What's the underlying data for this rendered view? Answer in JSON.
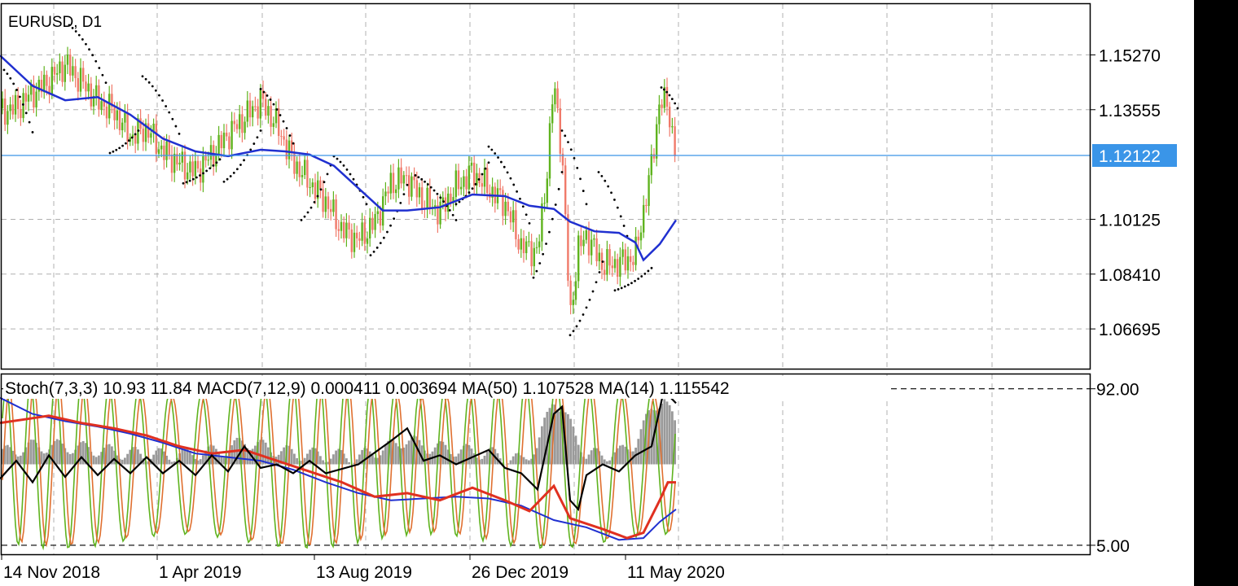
{
  "symbol_label": "EURUSD, D1",
  "current_price_label": "1.12122",
  "indicator_label": "Stoch(7,3,3) 10.93 11.84 MACD(7,12,9) 0.000411 0.003694 MA(50) 1.107528 MA(14) 1.115542",
  "colors": {
    "bull_candle": "#5fb31e",
    "bear_candle": "#f07a6a",
    "ma_line": "#2030d0",
    "sar_dots": "#000000",
    "price_line": "#3a95e8",
    "stoch_main": "#5fb31e",
    "stoch_signal": "#e07030",
    "macd_hist": "#9a9a9a",
    "macd_line": "#000000",
    "ma50_line": "#2030d0",
    "ma14_line": "#e03020",
    "grid": "#b0b0b0"
  },
  "chart_data": [
    {
      "type": "candlestick",
      "symbol": "EURUSD",
      "timeframe": "D1",
      "x_tick_labels": [
        "14 Nov 2018",
        "1 Apr 2019",
        "13 Aug 2019",
        "26 Dec 2019",
        "11 May 2020"
      ],
      "y_tick_labels": [
        "1.15270",
        "1.13555",
        "1.10125",
        "1.08410",
        "1.06695"
      ],
      "y_ticks": [
        1.1527,
        1.13555,
        1.10125,
        1.0841,
        1.06695
      ],
      "ylim": [
        1.0545,
        1.1686
      ],
      "current_price": 1.12122,
      "grid": true,
      "close_series": [
        [
          0,
          1.136
        ],
        [
          20,
          1.138
        ],
        [
          40,
          1.143
        ],
        [
          60,
          1.146
        ],
        [
          80,
          1.15
        ],
        [
          100,
          1.143
        ],
        [
          120,
          1.136
        ],
        [
          140,
          1.133
        ],
        [
          160,
          1.126
        ],
        [
          180,
          1.13
        ],
        [
          200,
          1.124
        ],
        [
          220,
          1.121
        ],
        [
          240,
          1.118
        ],
        [
          260,
          1.122
        ],
        [
          280,
          1.127
        ],
        [
          300,
          1.131
        ],
        [
          320,
          1.136
        ],
        [
          340,
          1.129
        ],
        [
          360,
          1.119
        ],
        [
          380,
          1.114
        ],
        [
          400,
          1.109
        ],
        [
          420,
          1.1
        ],
        [
          440,
          1.096
        ],
        [
          460,
          1.1
        ],
        [
          480,
          1.111
        ],
        [
          500,
          1.112
        ],
        [
          520,
          1.105
        ],
        [
          540,
          1.103
        ],
        [
          560,
          1.112
        ],
        [
          580,
          1.118
        ],
        [
          600,
          1.113
        ],
        [
          620,
          1.108
        ],
        [
          640,
          1.093
        ],
        [
          660,
          1.09
        ],
        [
          670,
          1.11
        ],
        [
          680,
          1.142
        ],
        [
          690,
          1.12
        ],
        [
          700,
          1.068
        ],
        [
          710,
          1.09
        ],
        [
          720,
          1.095
        ],
        [
          740,
          1.087
        ],
        [
          760,
          1.089
        ],
        [
          780,
          1.092
        ],
        [
          800,
          1.12
        ],
        [
          810,
          1.14
        ],
        [
          820,
          1.138
        ],
        [
          830,
          1.121
        ]
      ],
      "sma_series": [
        [
          0,
          1.1525
        ],
        [
          40,
          1.143
        ],
        [
          80,
          1.1385
        ],
        [
          120,
          1.1395
        ],
        [
          160,
          1.134
        ],
        [
          200,
          1.1265
        ],
        [
          240,
          1.1225
        ],
        [
          280,
          1.121
        ],
        [
          320,
          1.123
        ],
        [
          350,
          1.1225
        ],
        [
          380,
          1.1215
        ],
        [
          410,
          1.118
        ],
        [
          440,
          1.111
        ],
        [
          470,
          1.104
        ],
        [
          500,
          1.104
        ],
        [
          540,
          1.105
        ],
        [
          580,
          1.109
        ],
        [
          620,
          1.1085
        ],
        [
          650,
          1.1055
        ],
        [
          680,
          1.1045
        ],
        [
          700,
          1.1005
        ],
        [
          730,
          1.0975
        ],
        [
          760,
          1.097
        ],
        [
          780,
          1.094
        ],
        [
          790,
          1.0885
        ],
        [
          810,
          1.0935
        ],
        [
          830,
          1.101
        ]
      ],
      "sar_segments": [
        {
          "x": [
            5,
            40
          ],
          "y": [
            1.148,
            1.1285
          ]
        },
        {
          "x": [
            85,
            130
          ],
          "y": [
            1.162,
            1.144
          ]
        },
        {
          "x": [
            135,
            170
          ],
          "y": [
            1.122,
            1.129
          ]
        },
        {
          "x": [
            175,
            220
          ],
          "y": [
            1.146,
            1.128
          ]
        },
        {
          "x": [
            225,
            270
          ],
          "y": [
            1.1125,
            1.12
          ]
        },
        {
          "x": [
            275,
            320
          ],
          "y": [
            1.113,
            1.129
          ]
        },
        {
          "x": [
            320,
            360
          ],
          "y": [
            1.142,
            1.125
          ]
        },
        {
          "x": [
            370,
            410
          ],
          "y": [
            1.101,
            1.121
          ]
        },
        {
          "x": [
            410,
            450
          ],
          "y": [
            1.121,
            1.106
          ]
        },
        {
          "x": [
            455,
            500
          ],
          "y": [
            1.09,
            1.112
          ]
        },
        {
          "x": [
            510,
            560
          ],
          "y": [
            1.115,
            1.101
          ]
        },
        {
          "x": [
            560,
            600
          ],
          "y": [
            1.106,
            1.119
          ]
        },
        {
          "x": [
            600,
            650
          ],
          "y": [
            1.124,
            1.1
          ]
        },
        {
          "x": [
            655,
            690
          ],
          "y": [
            1.083,
            1.116
          ]
        },
        {
          "x": [
            690,
            720
          ],
          "y": [
            1.129,
            1.106
          ]
        },
        {
          "x": [
            700,
            740
          ],
          "y": [
            1.065,
            1.088
          ]
        },
        {
          "x": [
            735,
            770
          ],
          "y": [
            1.116,
            1.096
          ]
        },
        {
          "x": [
            755,
            800
          ],
          "y": [
            1.079,
            1.086
          ]
        },
        {
          "x": [
            812,
            832
          ],
          "y": [
            1.1425,
            1.136
          ]
        }
      ]
    },
    {
      "type": "line",
      "indicators": "Stoch(7,3,3), MACD(7,12,9), MA(50), MA(14)",
      "y_tick_labels": [
        "92.00",
        "5.00"
      ],
      "y_ticks": [
        92.0,
        5.0
      ],
      "ylim": [
        0,
        100
      ],
      "levels": [
        92.0,
        5.0
      ],
      "values_shown": [
        10.93,
        11.84,
        0.000411,
        0.003694,
        1.107528,
        1.115542
      ],
      "stoch_period_ticks": 34,
      "macd_hist_series": [
        [
          0,
          56
        ],
        [
          40,
          60
        ],
        [
          80,
          60
        ],
        [
          120,
          58
        ],
        [
          160,
          56
        ],
        [
          200,
          55
        ],
        [
          240,
          56
        ],
        [
          280,
          58
        ],
        [
          300,
          63
        ],
        [
          320,
          60
        ],
        [
          360,
          56
        ],
        [
          400,
          55
        ],
        [
          440,
          54
        ],
        [
          480,
          60
        ],
        [
          500,
          64
        ],
        [
          520,
          60
        ],
        [
          560,
          58
        ],
        [
          600,
          56
        ],
        [
          640,
          52
        ],
        [
          660,
          60
        ],
        [
          680,
          88
        ],
        [
          700,
          72
        ],
        [
          720,
          55
        ],
        [
          760,
          56
        ],
        [
          780,
          62
        ],
        [
          800,
          80
        ],
        [
          815,
          88
        ],
        [
          830,
          70
        ]
      ],
      "macd_line_series": [
        [
          0,
          42
        ],
        [
          20,
          52
        ],
        [
          40,
          40
        ],
        [
          60,
          55
        ],
        [
          80,
          43
        ],
        [
          100,
          54
        ],
        [
          120,
          44
        ],
        [
          140,
          53
        ],
        [
          160,
          45
        ],
        [
          180,
          54
        ],
        [
          200,
          45
        ],
        [
          220,
          52
        ],
        [
          240,
          44
        ],
        [
          260,
          55
        ],
        [
          280,
          46
        ],
        [
          300,
          60
        ],
        [
          320,
          48
        ],
        [
          340,
          50
        ],
        [
          360,
          45
        ],
        [
          380,
          52
        ],
        [
          400,
          45
        ],
        [
          440,
          50
        ],
        [
          480,
          63
        ],
        [
          500,
          70
        ],
        [
          520,
          52
        ],
        [
          540,
          55
        ],
        [
          560,
          50
        ],
        [
          600,
          58
        ],
        [
          620,
          48
        ],
        [
          640,
          45
        ],
        [
          660,
          36
        ],
        [
          680,
          78
        ],
        [
          690,
          82
        ],
        [
          700,
          30
        ],
        [
          710,
          25
        ],
        [
          720,
          44
        ],
        [
          740,
          50
        ],
        [
          760,
          46
        ],
        [
          780,
          55
        ],
        [
          800,
          60
        ],
        [
          815,
          91
        ],
        [
          830,
          84
        ]
      ],
      "ma50_series": [
        [
          0,
          87
        ],
        [
          40,
          78
        ],
        [
          80,
          74
        ],
        [
          120,
          71
        ],
        [
          160,
          67
        ],
        [
          200,
          62
        ],
        [
          240,
          56
        ],
        [
          280,
          54
        ],
        [
          320,
          52
        ],
        [
          360,
          47
        ],
        [
          400,
          40
        ],
        [
          440,
          34
        ],
        [
          480,
          30
        ],
        [
          520,
          31
        ],
        [
          560,
          32
        ],
        [
          600,
          31
        ],
        [
          640,
          27
        ],
        [
          680,
          19
        ],
        [
          720,
          15
        ],
        [
          760,
          8
        ],
        [
          790,
          9
        ],
        [
          810,
          18
        ],
        [
          830,
          25
        ]
      ],
      "ma14_series": [
        [
          0,
          73
        ],
        [
          30,
          75
        ],
        [
          60,
          77
        ],
        [
          100,
          73
        ],
        [
          140,
          70
        ],
        [
          180,
          66
        ],
        [
          220,
          60
        ],
        [
          260,
          56
        ],
        [
          300,
          58
        ],
        [
          340,
          52
        ],
        [
          380,
          46
        ],
        [
          420,
          40
        ],
        [
          460,
          32
        ],
        [
          500,
          34
        ],
        [
          540,
          30
        ],
        [
          580,
          37
        ],
        [
          620,
          30
        ],
        [
          650,
          24
        ],
        [
          680,
          38
        ],
        [
          700,
          20
        ],
        [
          740,
          14
        ],
        [
          770,
          9
        ],
        [
          790,
          12
        ],
        [
          810,
          30
        ],
        [
          820,
          40
        ],
        [
          830,
          40
        ]
      ]
    }
  ]
}
